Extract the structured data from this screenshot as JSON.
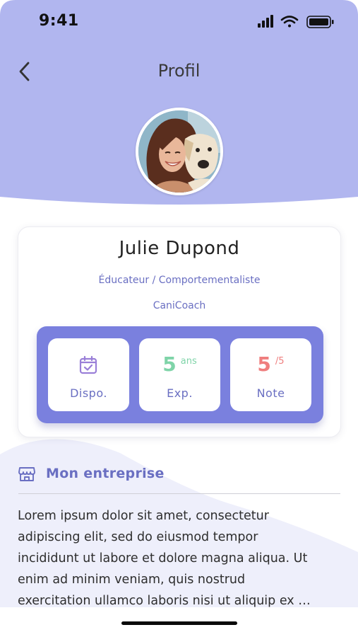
{
  "status_bar": {
    "time": "9:41"
  },
  "header": {
    "title": "Profil",
    "back_icon": "chevron-left-icon"
  },
  "colors": {
    "header_bg": "#b1b6ef",
    "accent": "#6a6fc2",
    "stats_bg": "#7a80de",
    "experience": "#7fd4a8",
    "rating": "#ef7e7e"
  },
  "profile": {
    "name": "Julie Dupond",
    "role": "Éducateur / Comportementaliste",
    "company": "CaniCoach",
    "avatar": "avatar-photo-woman-with-dog"
  },
  "stats": {
    "availability": {
      "icon": "calendar-check-icon",
      "label": "Dispo."
    },
    "experience": {
      "value": "5",
      "unit": "ans",
      "label": "Exp."
    },
    "rating": {
      "value": "5",
      "unit": "/5",
      "label": "Note"
    }
  },
  "company_section": {
    "icon": "store-icon",
    "title": "Mon entreprise",
    "description": "Lorem ipsum dolor sit amet, consectetur\nadipiscing elit, sed do eiusmod tempor\nincididunt ut labore et dolore magna aliqua. Ut\nenim ad minim veniam, quis nostrud\nexercitation ullamco laboris nisi ut aliquip ex …"
  }
}
